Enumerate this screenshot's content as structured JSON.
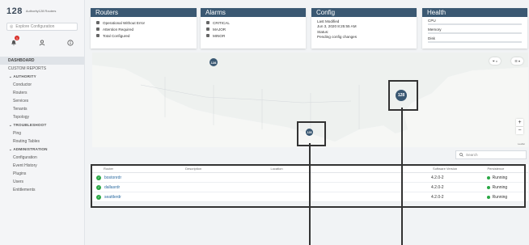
{
  "sidebar": {
    "brand_number": "128",
    "brand_name": "Authority128 Routers",
    "explore_label": "Explore Configuration",
    "alert_count": "1",
    "items": [
      {
        "label": "DASHBOARD",
        "type": "active"
      },
      {
        "label": "CUSTOM REPORTS",
        "type": "top"
      },
      {
        "label": "⌄ AUTHORITY",
        "type": "head"
      },
      {
        "label": "Conductor",
        "type": "item"
      },
      {
        "label": "Routers",
        "type": "item"
      },
      {
        "label": "Services",
        "type": "item"
      },
      {
        "label": "Tenants",
        "type": "item"
      },
      {
        "label": "Topology",
        "type": "item"
      },
      {
        "label": "⌄ TROUBLESHOOT",
        "type": "head"
      },
      {
        "label": "Ping",
        "type": "item"
      },
      {
        "label": "Routing Tables",
        "type": "item"
      },
      {
        "label": "⌄ ADMINISTRATION",
        "type": "head"
      },
      {
        "label": "Configuration",
        "type": "item"
      },
      {
        "label": "Event History",
        "type": "item"
      },
      {
        "label": "Plugins",
        "type": "item"
      },
      {
        "label": "Users",
        "type": "item"
      },
      {
        "label": "Entitlements",
        "type": "item"
      }
    ]
  },
  "cards": {
    "routers": {
      "title": "Routers",
      "rows": [
        "Operational Without Error",
        "Attention Required",
        "Total Configured"
      ]
    },
    "alarms": {
      "title": "Alarms",
      "rows": [
        "CRITICAL",
        "MAJOR",
        "MINOR"
      ]
    },
    "config": {
      "title": "Config",
      "rows": [
        "Last Modified",
        "Jun 3, 2020 8:25:55 AM",
        "Status:",
        "Pending config changes"
      ]
    },
    "health": {
      "title": "Health",
      "rows": [
        "CPU",
        "Memory",
        "Disk"
      ]
    }
  },
  "map": {
    "filter_label": "⏷ ▾",
    "layer_label": "☰ ▾",
    "markers": [
      "128",
      "128",
      "128"
    ],
    "zoom_in": "+",
    "zoom_out": "−",
    "attribution": "Leaflet"
  },
  "search": {
    "placeholder": "Search"
  },
  "table": {
    "columns": [
      "Router",
      "Description",
      "Location",
      "Software Version",
      "Persistence"
    ],
    "rows": [
      {
        "router": "bostonrdr",
        "description": "",
        "location": "",
        "version": "4.2.0-2",
        "persistence": "Running"
      },
      {
        "router": "dallasrdr",
        "description": "",
        "location": "",
        "version": "4.2.0-2",
        "persistence": "Running"
      },
      {
        "router": "seattlerdr",
        "description": "",
        "location": "",
        "version": "4.2.0-2",
        "persistence": "Running"
      }
    ]
  },
  "colors": {
    "header": "#3a5872",
    "ok": "#2aa745",
    "link": "#2b6aa0",
    "alert": "#d9322c"
  }
}
